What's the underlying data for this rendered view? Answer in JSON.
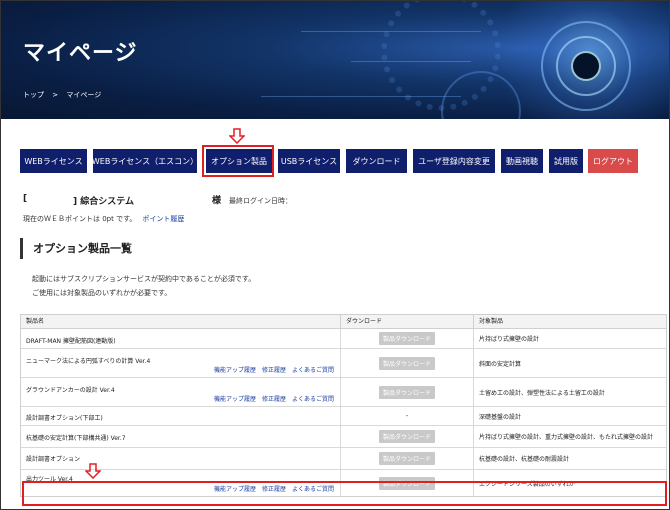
{
  "header": {
    "title": "マイページ",
    "breadcrumb": [
      "トップ",
      ">",
      "マイページ"
    ]
  },
  "nav": {
    "items": [
      {
        "label": "WEBライセンス"
      },
      {
        "label": "WEBライセンス（エスコン）"
      },
      {
        "label": "オプション製品"
      },
      {
        "label": "USBライセンス"
      },
      {
        "label": "ダウンロード"
      },
      {
        "label": "ユーザ登録内容変更"
      },
      {
        "label": "動画視聴"
      },
      {
        "label": "試用版"
      },
      {
        "label": "ログアウト"
      }
    ],
    "highlighted": "オプション製品"
  },
  "user": {
    "bracket_open": "[",
    "system_name": "] 綜合システム",
    "honorific": "様",
    "last_login_label": "最終ログイン日時：",
    "points_text": "現在のＷＥＢポイントは 0pt です。",
    "points_link": "ポイント履歴"
  },
  "section": {
    "title": "オプション製品一覧",
    "note1": "起動にはサブスクリプションサービスが契約中であることが必須です。",
    "note2": "ご使用には対象製品のいずれかが必要です。"
  },
  "table": {
    "headers": [
      "製品名",
      "ダウンロード",
      "対象製品"
    ],
    "download_label": "製品ダウンロード",
    "link_labels": [
      "機能アップ履歴",
      "修正履歴",
      "よくあるご質問"
    ],
    "rows": [
      {
        "name": "DRAFT-MAN 擁壁配筋図(連動版)",
        "download": "製品ダウンロード",
        "target": "片持ばり式擁壁の設計"
      },
      {
        "name": "ニューマーク法による円弧すべりの計算 Ver.4",
        "download": "製品ダウンロード",
        "target": "斜面の安定計算"
      },
      {
        "name": "グラウンドアンカーの設計 Ver.4",
        "download": "製品ダウンロード",
        "target": "土留め工の設計、弾塑性法による土留工の設計"
      },
      {
        "name": "設計調書オプション(下部工)",
        "download": "-",
        "target": "深礎基盤の設計"
      },
      {
        "name": "杭基礎の安定計算(下部構共通) Ver.7",
        "download": "製品ダウンロード",
        "target": "片持ばり式擁壁の設計、重力式擁壁の設計、もたれ式擁壁の設計"
      },
      {
        "name": "設計調書オプション",
        "download": "製品ダウンロード",
        "target": "杭基礎の設計、杭基礎の耐震設計"
      },
      {
        "name": "出力ツール Ver.4",
        "download": "製品ダウンロード",
        "target": "エクシードシリーズ製品のいずれか"
      }
    ]
  },
  "colors": {
    "nav_bg": "#101f6b",
    "logout_bg": "#d94a4a",
    "highlight": "#e02020",
    "link": "#1a3fa0"
  }
}
